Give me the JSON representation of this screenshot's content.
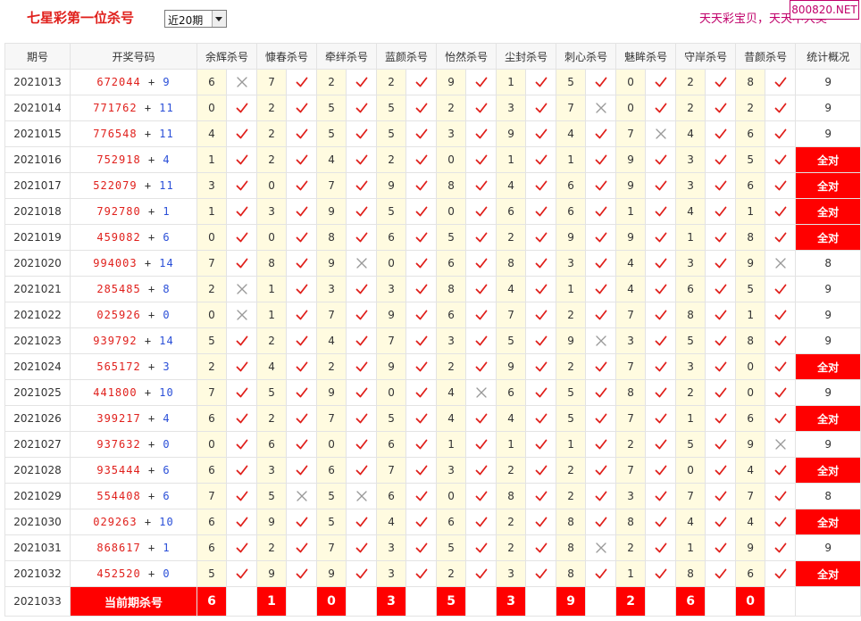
{
  "header": {
    "title": "七星彩第一位杀号",
    "period_select": "近20期",
    "brand_text": "天天彩宝贝，天天中大奖",
    "site_badge": "800820.NET"
  },
  "columns": [
    "期号",
    "开奖号码",
    "余辉杀号",
    "慷春杀号",
    "牵绊杀号",
    "蓝颜杀号",
    "怡然杀号",
    "尘封杀号",
    "刺心杀号",
    "魅眸杀号",
    "守岸杀号",
    "昔颜杀号",
    "统计概况"
  ],
  "all_right_label": "全对",
  "rows": [
    {
      "issue": "2021013",
      "main": "672044",
      "bonus": "9",
      "kills": [
        6,
        7,
        2,
        2,
        9,
        1,
        5,
        0,
        2,
        8
      ],
      "hits": [
        false,
        true,
        true,
        true,
        true,
        true,
        true,
        true,
        true,
        true
      ],
      "total": "9",
      "allright": false
    },
    {
      "issue": "2021014",
      "main": "771762",
      "bonus": "11",
      "kills": [
        0,
        2,
        5,
        5,
        2,
        3,
        7,
        0,
        2,
        2
      ],
      "hits": [
        true,
        true,
        true,
        true,
        true,
        true,
        false,
        true,
        true,
        true
      ],
      "total": "9",
      "allright": false
    },
    {
      "issue": "2021015",
      "main": "776548",
      "bonus": "11",
      "kills": [
        4,
        2,
        5,
        5,
        3,
        9,
        4,
        7,
        4,
        6
      ],
      "hits": [
        true,
        true,
        true,
        true,
        true,
        true,
        true,
        false,
        true,
        true
      ],
      "total": "9",
      "allright": false
    },
    {
      "issue": "2021016",
      "main": "752918",
      "bonus": "4",
      "kills": [
        1,
        2,
        4,
        2,
        0,
        1,
        1,
        9,
        3,
        5
      ],
      "hits": [
        true,
        true,
        true,
        true,
        true,
        true,
        true,
        true,
        true,
        true
      ],
      "total": "全对",
      "allright": true
    },
    {
      "issue": "2021017",
      "main": "522079",
      "bonus": "11",
      "kills": [
        3,
        0,
        7,
        9,
        8,
        4,
        6,
        9,
        3,
        6
      ],
      "hits": [
        true,
        true,
        true,
        true,
        true,
        true,
        true,
        true,
        true,
        true
      ],
      "total": "全对",
      "allright": true
    },
    {
      "issue": "2021018",
      "main": "792780",
      "bonus": "1",
      "kills": [
        1,
        3,
        9,
        5,
        0,
        6,
        6,
        1,
        4,
        1
      ],
      "hits": [
        true,
        true,
        true,
        true,
        true,
        true,
        true,
        true,
        true,
        true
      ],
      "total": "全对",
      "allright": true
    },
    {
      "issue": "2021019",
      "main": "459082",
      "bonus": "6",
      "kills": [
        0,
        0,
        8,
        6,
        5,
        2,
        9,
        9,
        1,
        8
      ],
      "hits": [
        true,
        true,
        true,
        true,
        true,
        true,
        true,
        true,
        true,
        true
      ],
      "total": "全对",
      "allright": true
    },
    {
      "issue": "2021020",
      "main": "994003",
      "bonus": "14",
      "kills": [
        7,
        8,
        9,
        0,
        6,
        8,
        3,
        4,
        3,
        9
      ],
      "hits": [
        true,
        true,
        false,
        true,
        true,
        true,
        true,
        true,
        true,
        false
      ],
      "total": "8",
      "allright": false
    },
    {
      "issue": "2021021",
      "main": "285485",
      "bonus": "8",
      "kills": [
        2,
        1,
        3,
        3,
        8,
        4,
        1,
        4,
        6,
        5
      ],
      "hits": [
        false,
        true,
        true,
        true,
        true,
        true,
        true,
        true,
        true,
        true
      ],
      "total": "9",
      "allright": false
    },
    {
      "issue": "2021022",
      "main": "025926",
      "bonus": "0",
      "kills": [
        0,
        1,
        7,
        9,
        6,
        7,
        2,
        7,
        8,
        1
      ],
      "hits": [
        false,
        true,
        true,
        true,
        true,
        true,
        true,
        true,
        true,
        true
      ],
      "total": "9",
      "allright": false
    },
    {
      "issue": "2021023",
      "main": "939792",
      "bonus": "14",
      "kills": [
        5,
        2,
        4,
        7,
        3,
        5,
        9,
        3,
        5,
        8
      ],
      "hits": [
        true,
        true,
        true,
        true,
        true,
        true,
        false,
        true,
        true,
        true
      ],
      "total": "9",
      "allright": false
    },
    {
      "issue": "2021024",
      "main": "565172",
      "bonus": "3",
      "kills": [
        2,
        4,
        2,
        9,
        2,
        9,
        2,
        7,
        3,
        0
      ],
      "hits": [
        true,
        true,
        true,
        true,
        true,
        true,
        true,
        true,
        true,
        true
      ],
      "total": "全对",
      "allright": true
    },
    {
      "issue": "2021025",
      "main": "441800",
      "bonus": "10",
      "kills": [
        7,
        5,
        9,
        0,
        4,
        6,
        5,
        8,
        2,
        0
      ],
      "hits": [
        true,
        true,
        true,
        true,
        false,
        true,
        true,
        true,
        true,
        true
      ],
      "total": "9",
      "allright": false
    },
    {
      "issue": "2021026",
      "main": "399217",
      "bonus": "4",
      "kills": [
        6,
        2,
        7,
        5,
        4,
        4,
        5,
        7,
        1,
        6
      ],
      "hits": [
        true,
        true,
        true,
        true,
        true,
        true,
        true,
        true,
        true,
        true
      ],
      "total": "全对",
      "allright": true
    },
    {
      "issue": "2021027",
      "main": "937632",
      "bonus": "0",
      "kills": [
        0,
        6,
        0,
        6,
        1,
        1,
        1,
        2,
        5,
        9
      ],
      "hits": [
        true,
        true,
        true,
        true,
        true,
        true,
        true,
        true,
        true,
        false
      ],
      "total": "9",
      "allright": false
    },
    {
      "issue": "2021028",
      "main": "935444",
      "bonus": "6",
      "kills": [
        6,
        3,
        6,
        7,
        3,
        2,
        2,
        7,
        0,
        4
      ],
      "hits": [
        true,
        true,
        true,
        true,
        true,
        true,
        true,
        true,
        true,
        true
      ],
      "total": "全对",
      "allright": true
    },
    {
      "issue": "2021029",
      "main": "554408",
      "bonus": "6",
      "kills": [
        7,
        5,
        5,
        6,
        0,
        8,
        2,
        3,
        7,
        7
      ],
      "hits": [
        true,
        false,
        false,
        true,
        true,
        true,
        true,
        true,
        true,
        true
      ],
      "total": "8",
      "allright": false
    },
    {
      "issue": "2021030",
      "main": "029263",
      "bonus": "10",
      "kills": [
        6,
        9,
        5,
        4,
        6,
        2,
        8,
        8,
        4,
        4
      ],
      "hits": [
        true,
        true,
        true,
        true,
        true,
        true,
        true,
        true,
        true,
        true
      ],
      "total": "全对",
      "allright": true
    },
    {
      "issue": "2021031",
      "main": "868617",
      "bonus": "1",
      "kills": [
        6,
        2,
        7,
        3,
        5,
        2,
        8,
        2,
        1,
        9
      ],
      "hits": [
        true,
        true,
        true,
        true,
        true,
        true,
        false,
        true,
        true,
        true
      ],
      "total": "9",
      "allright": false
    },
    {
      "issue": "2021032",
      "main": "452520",
      "bonus": "0",
      "kills": [
        5,
        9,
        9,
        3,
        2,
        3,
        8,
        1,
        8,
        6
      ],
      "hits": [
        true,
        true,
        true,
        true,
        true,
        true,
        true,
        true,
        true,
        true
      ],
      "total": "全对",
      "allright": true
    }
  ],
  "current": {
    "issue": "2021033",
    "label": "当前期杀号",
    "kills": [
      6,
      1,
      0,
      3,
      5,
      3,
      9,
      2,
      6,
      0
    ]
  },
  "colors": {
    "accent": "#e0201c",
    "bonus": "#2a4fd8",
    "highlight": "#ff0000",
    "num_bg": "#fffbe0",
    "check": "#e0201c",
    "cross": "#999999"
  }
}
